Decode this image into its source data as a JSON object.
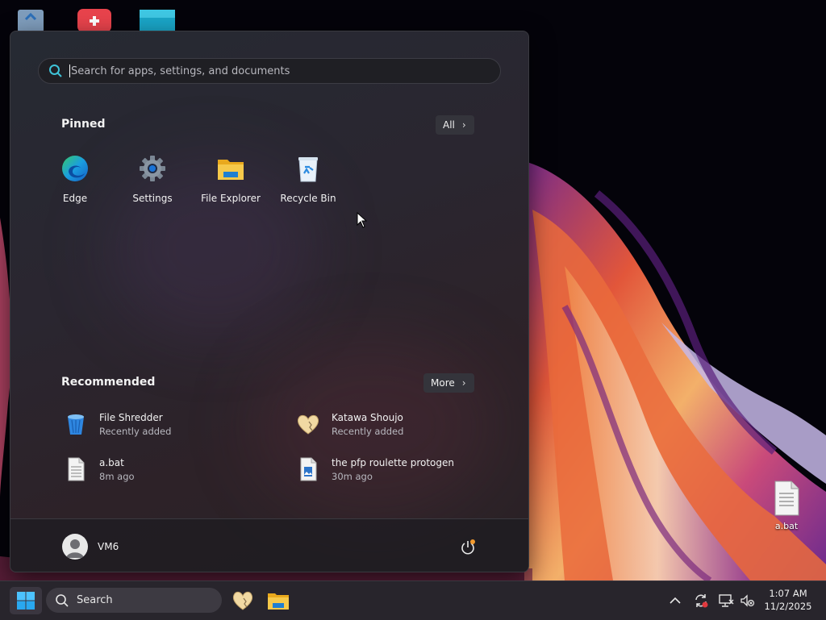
{
  "start_menu": {
    "search_placeholder": "Search for apps, settings, and documents",
    "pinned_title": "Pinned",
    "all_button": "All",
    "pinned_apps": [
      {
        "label": "Edge",
        "icon": "edge-icon"
      },
      {
        "label": "Settings",
        "icon": "gear-icon"
      },
      {
        "label": "File Explorer",
        "icon": "folder-icon"
      },
      {
        "label": "Recycle Bin",
        "icon": "recycle-bin-icon"
      }
    ],
    "recommended_title": "Recommended",
    "more_button": "More",
    "recommended": [
      {
        "name": "File Shredder",
        "detail": "Recently added",
        "icon": "shredder-icon"
      },
      {
        "name": "Katawa Shoujo",
        "detail": "Recently added",
        "icon": "heart-icon"
      },
      {
        "name": "a.bat",
        "detail": "8m ago",
        "icon": "document-icon"
      },
      {
        "name": "the pfp roulette protogen",
        "detail": "30m ago",
        "icon": "image-file-icon"
      }
    ],
    "user_name": "VM6"
  },
  "desktop": {
    "file_label": "a.bat"
  },
  "taskbar": {
    "search_label": "Search",
    "time": "1:07 AM",
    "date": "11/2/2025"
  },
  "colors": {
    "accent": "#0078d4",
    "folder": "#f4c02f",
    "notification_dot": "#e0393e"
  }
}
